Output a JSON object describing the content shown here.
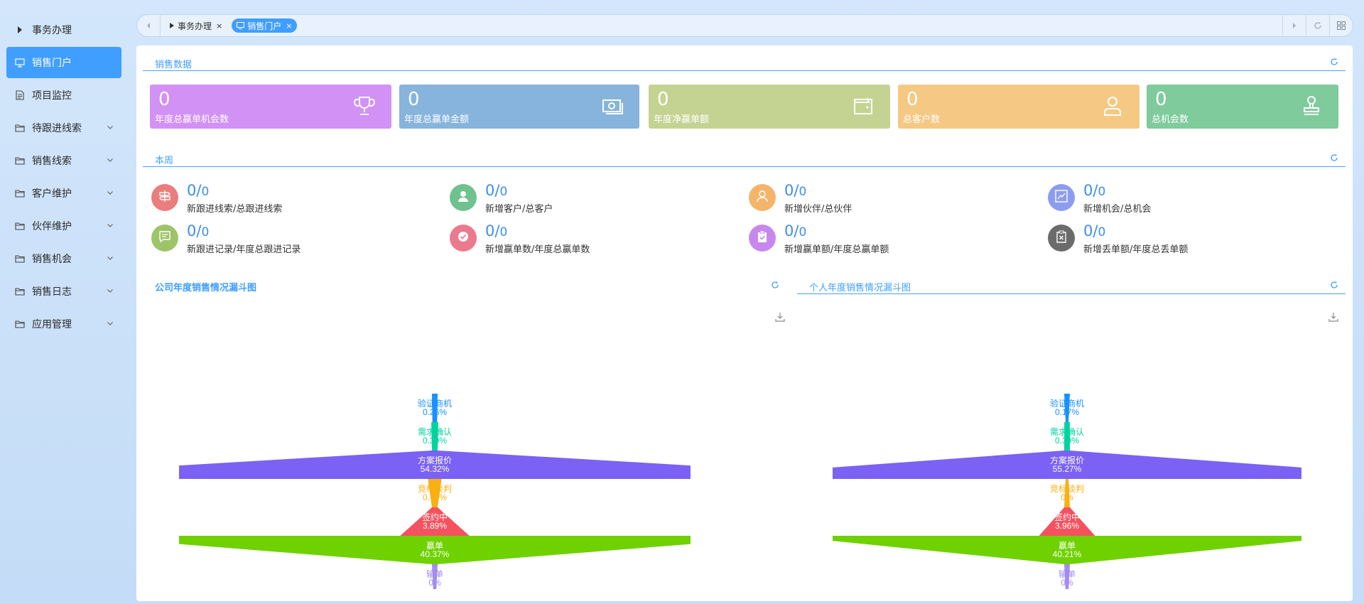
{
  "sidebar": {
    "items": [
      {
        "label": "事务办理",
        "icon": "caret-right-icon",
        "active": false,
        "expandable": false
      },
      {
        "label": "销售门户",
        "icon": "desktop-icon",
        "active": true,
        "expandable": false
      },
      {
        "label": "项目监控",
        "icon": "document-icon",
        "active": false,
        "expandable": false
      },
      {
        "label": "待跟进线索",
        "icon": "folder-icon",
        "active": false,
        "expandable": true
      },
      {
        "label": "销售线索",
        "icon": "folder-icon",
        "active": false,
        "expandable": true
      },
      {
        "label": "客户维护",
        "icon": "folder-icon",
        "active": false,
        "expandable": true
      },
      {
        "label": "伙伴维护",
        "icon": "folder-icon",
        "active": false,
        "expandable": true
      },
      {
        "label": "销售机会",
        "icon": "folder-icon",
        "active": false,
        "expandable": true
      },
      {
        "label": "销售日志",
        "icon": "folder-icon",
        "active": false,
        "expandable": true
      },
      {
        "label": "应用管理",
        "icon": "folder-icon",
        "active": false,
        "expandable": true
      }
    ]
  },
  "tabs": [
    {
      "label": "事务办理",
      "active": false
    },
    {
      "label": "销售门户",
      "active": true
    }
  ],
  "tab_close": "×",
  "sales_data": {
    "title": "销售数据",
    "cards": [
      {
        "value": "0",
        "label": "年度总赢单机会数",
        "color": "#d291f5",
        "icon": "trophy-icon"
      },
      {
        "value": "0",
        "label": "年度总赢单金额",
        "color": "#86b4dc",
        "icon": "money-icon"
      },
      {
        "value": "0",
        "label": "年度净赢单额",
        "color": "#c5d392",
        "icon": "wallet-icon"
      },
      {
        "value": "0",
        "label": "总客户数",
        "color": "#f5c983",
        "icon": "user-icon"
      },
      {
        "value": "0",
        "label": "总机会数",
        "color": "#7fcb9c",
        "icon": "stamp-icon"
      }
    ]
  },
  "this_week": {
    "title": "本周",
    "items": [
      {
        "num": "0/",
        "den": "0",
        "label": "新跟进线索/总跟进线索",
        "color": "#ea7d7d",
        "icon": "signpost-icon"
      },
      {
        "num": "0/",
        "den": "0",
        "label": "新增客户/总客户",
        "color": "#6fc28e",
        "icon": "person-icon"
      },
      {
        "num": "0/",
        "den": "0",
        "label": "新增伙伴/总伙伴",
        "color": "#f4b56a",
        "icon": "partner-icon"
      },
      {
        "num": "0/",
        "den": "0",
        "label": "新增机会/总机会",
        "color": "#8c9df0",
        "icon": "trend-icon"
      },
      {
        "num": "0/",
        "den": "0",
        "label": "新跟进记录/年度总跟进记录",
        "color": "#9ec46a",
        "icon": "comment-icon"
      },
      {
        "num": "0/",
        "den": "0",
        "label": "新增赢单数/年度总赢单数",
        "color": "#ec7a8f",
        "icon": "check-icon"
      },
      {
        "num": "0/",
        "den": "0",
        "label": "新增赢单额/年度总赢单额",
        "color": "#c788ee",
        "icon": "clipboard-check-icon"
      },
      {
        "num": "0/",
        "den": "0",
        "label": "新增丢单额/年度总丢单额",
        "color": "#6b6b6b",
        "icon": "clipboard-x-icon"
      }
    ]
  },
  "chart_data": [
    {
      "type": "funnel",
      "title": "公司年度销售情况漏斗图",
      "categories": [
        "验证商机",
        "需求确认",
        "方案报价",
        "竞标谈判",
        "签约中",
        "赢单",
        "输单"
      ],
      "values": [
        0.26,
        0.39,
        54.32,
        0.77,
        3.89,
        40.37,
        0
      ],
      "labels": [
        "0.26%",
        "0.39%",
        "54.32%",
        "0.77%",
        "3.89%",
        "40.37%",
        "0%"
      ],
      "colors": [
        "#1890ff",
        "#00d39e",
        "#7b62f4",
        "#f8b012",
        "#f5515f",
        "#6fd100",
        "#a48bf0"
      ]
    },
    {
      "type": "funnel",
      "title": "个人年度销售情况漏斗图",
      "categories": [
        "验证商机",
        "需求确认",
        "方案报价",
        "竞标谈判",
        "签约中",
        "赢单",
        "输单"
      ],
      "values": [
        0.17,
        0.39,
        55.27,
        0,
        3.96,
        40.21,
        0
      ],
      "labels": [
        "0.17%",
        "0.39%",
        "55.27%",
        "0%",
        "3.96%",
        "40.21%",
        "0%"
      ],
      "colors": [
        "#1890ff",
        "#00d39e",
        "#7b62f4",
        "#f8b012",
        "#f5515f",
        "#6fd100",
        "#a48bf0"
      ]
    }
  ]
}
